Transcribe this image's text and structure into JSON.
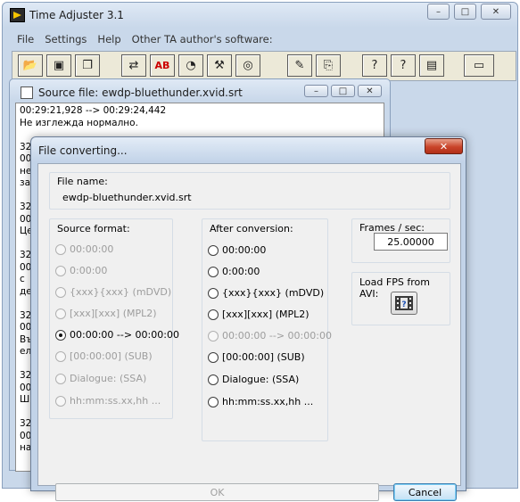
{
  "app": {
    "title": "Time Adjuster 3.1",
    "caption_min": "–",
    "caption_max": "□",
    "caption_close": "✕"
  },
  "menu": [
    "File",
    "Settings",
    "Help",
    "Other TA author's software:"
  ],
  "toolbar_icons": [
    "open-folder-icon",
    "save-icon",
    "save-all-icon",
    "swap-arrows-icon",
    "a-b-replace-icon",
    "clock-icon",
    "hammer-icon",
    "film-reel-icon",
    "document-edit-icon",
    "document-merge-icon",
    "help-document-icon",
    "help-film-icon",
    "report-icon",
    "window-icon"
  ],
  "child": {
    "title": "Source file: ewdp-bluethunder.xvid.srt",
    "lines": [
      "00:29:21,928 --> 00:29:24,442",
      "Не изглежда нормално.",
      "",
      "32",
      "00",
      "не",
      "за",
      "",
      "32",
      "00",
      "Це",
      "",
      "32",
      "00",
      "с",
      "де",
      "",
      "32",
      "00",
      "Въ",
      "ел",
      "",
      "32",
      "00",
      "Ши",
      "",
      "32",
      "00",
      "на"
    ]
  },
  "dialog": {
    "title": "File converting...",
    "close_label": "✕",
    "file_name_label": "File name:",
    "file_name_value": "ewdp-bluethunder.xvid.srt",
    "source_format": {
      "label": "Source format:",
      "options": [
        "00:00:00",
        "0:00:00",
        "{xxx}{xxx}    (mDVD)",
        "[xxx][xxx]    (MPL2)",
        "00:00:00 --> 00:00:00",
        "[00:00:00]  (SUB)",
        "Dialogue:    (SSA)",
        "hh:mm:ss.xx,hh ..."
      ],
      "selected_index": 4
    },
    "after_conversion": {
      "label": "After conversion:",
      "options": [
        "00:00:00",
        "0:00:00",
        "{xxx}{xxx}    (mDVD)",
        "[xxx][xxx]    (MPL2)",
        "00:00:00 --> 00:00:00",
        "[00:00:00]  (SUB)",
        "Dialogue:    (SSA)",
        "hh:mm:ss.xx,hh ..."
      ],
      "disabled_index": 4
    },
    "frames_per_sec": {
      "label": "Frames / sec:",
      "value": "25.00000"
    },
    "load_fps": {
      "label": "Load FPS from AVI:"
    },
    "ok_label": "OK",
    "cancel_label": "Cancel"
  }
}
